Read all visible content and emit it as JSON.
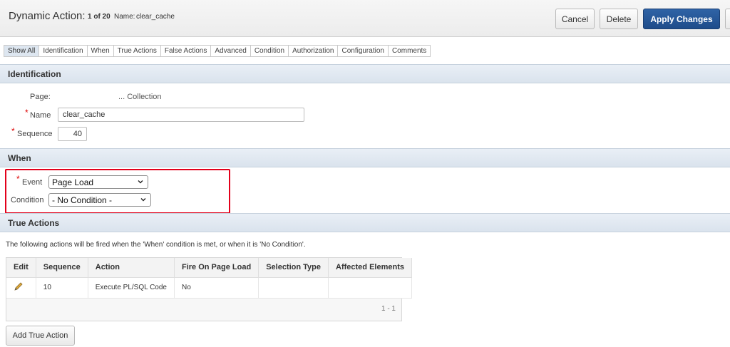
{
  "header": {
    "title": "Dynamic Action:",
    "counter": "1 of 20",
    "name_label": "Name:",
    "name_value": "clear_cache",
    "buttons": {
      "cancel": "Cancel",
      "delete": "Delete",
      "apply": "Apply Changes"
    }
  },
  "tabs": [
    {
      "label": "Show All"
    },
    {
      "label": "Identification"
    },
    {
      "label": "When"
    },
    {
      "label": "True Actions"
    },
    {
      "label": "False Actions"
    },
    {
      "label": "Advanced"
    },
    {
      "label": "Condition"
    },
    {
      "label": "Authorization"
    },
    {
      "label": "Configuration"
    },
    {
      "label": "Comments"
    }
  ],
  "identification": {
    "heading": "Identification",
    "page_label": "Page:",
    "page_value": "... Collection",
    "name_label": "Name",
    "name_value": "clear_cache",
    "sequence_label": "Sequence",
    "sequence_value": "40",
    "required_mark": "*"
  },
  "when": {
    "heading": "When",
    "event_label": "Event",
    "event_value": "Page Load",
    "condition_label": "Condition",
    "condition_value": "- No Condition -",
    "required_mark": "*"
  },
  "true_actions": {
    "heading": "True Actions",
    "note": "The following actions will be fired when the 'When' condition is met, or when it is 'No Condition'.",
    "columns": [
      "Edit",
      "Sequence",
      "Action",
      "Fire On Page Load",
      "Selection Type",
      "Affected Elements"
    ],
    "rows": [
      {
        "sequence": "10",
        "action": "Execute PL/SQL Code",
        "fire_on_page_load": "No",
        "selection_type": "",
        "affected_elements": ""
      }
    ],
    "pagination": "1 - 1",
    "add_button": "Add True Action"
  },
  "colors": {
    "accent": "#1e4c8a",
    "section_bar": "#dde6f0",
    "highlight": "#e3001b",
    "required": "#dd0000"
  },
  "icons": {
    "edit": "pencil-icon",
    "select_arrow": "chevron-down-icon"
  }
}
